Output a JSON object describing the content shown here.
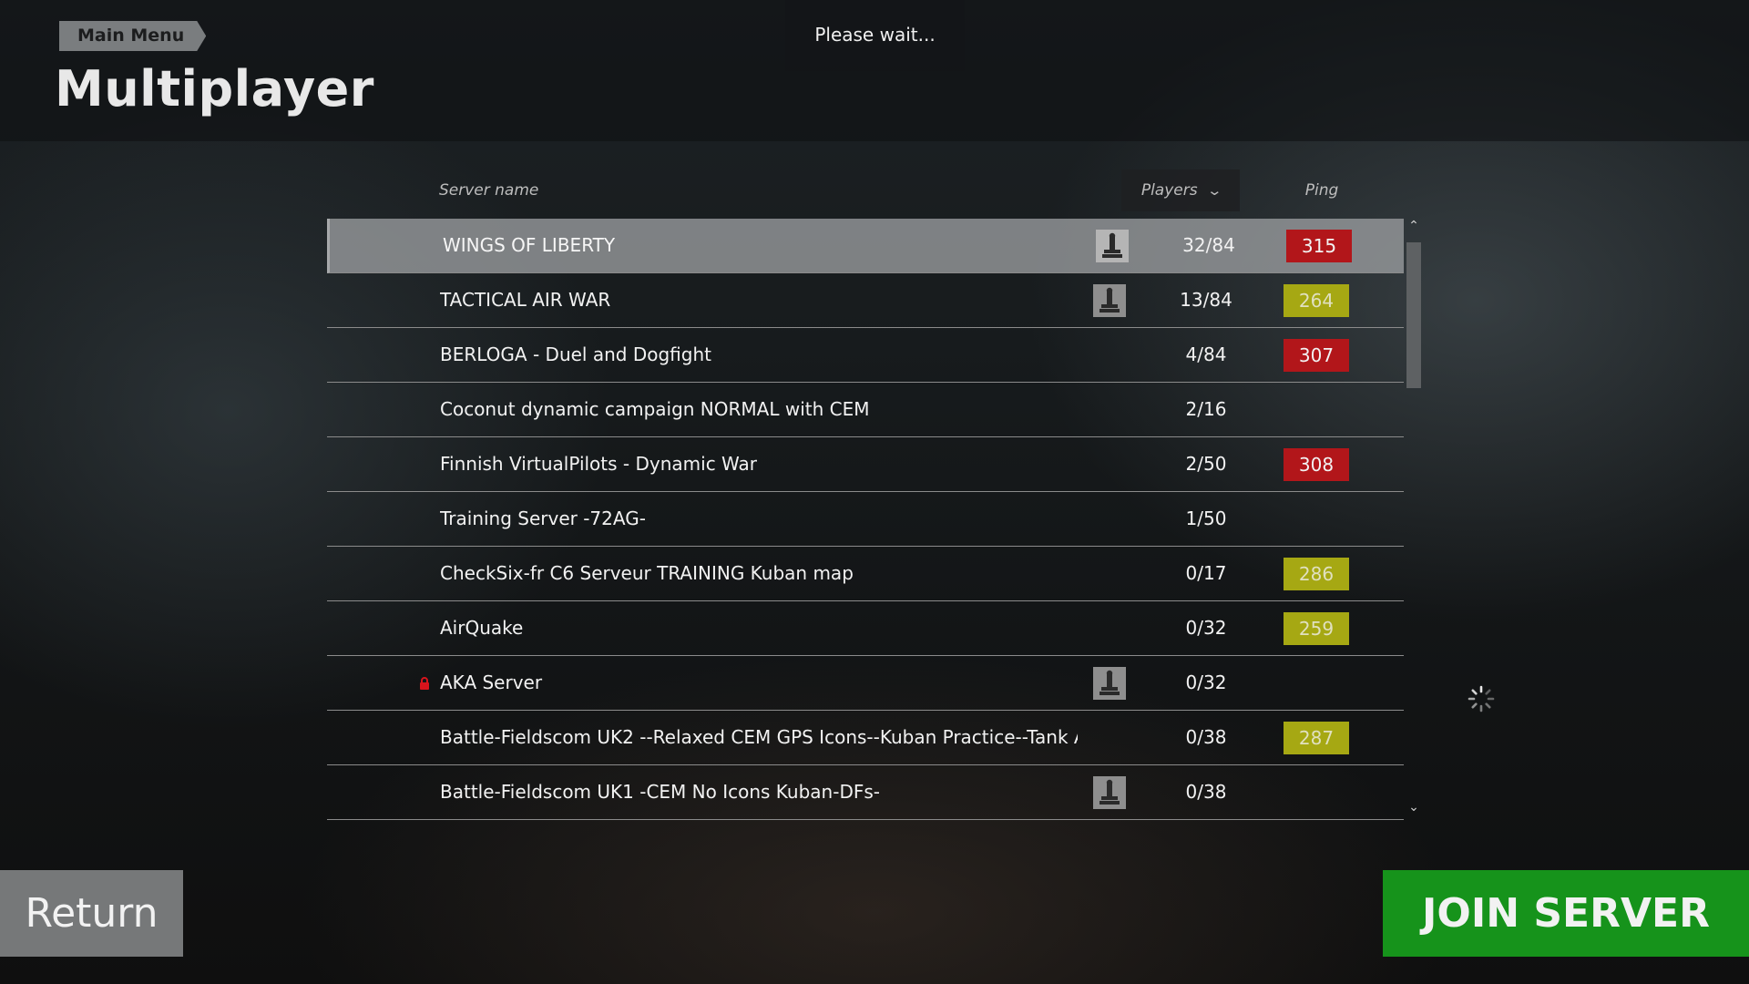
{
  "header": {
    "breadcrumb": "Main Menu",
    "title": "Multiplayer",
    "wait_message": "Please wait..."
  },
  "table": {
    "columns": {
      "server": "Server name",
      "players": "Players",
      "ping": "Ping"
    },
    "rows": [
      {
        "name": "WINGS OF LIBERTY",
        "players": "32/84",
        "ping": "315",
        "ping_level": "red",
        "mod_icon": true,
        "locked": false,
        "selected": true
      },
      {
        "name": "TACTICAL AIR WAR",
        "players": "13/84",
        "ping": "264",
        "ping_level": "yellow",
        "mod_icon": true,
        "locked": false,
        "selected": false
      },
      {
        "name": "BERLOGA - Duel and Dogfight",
        "players": "4/84",
        "ping": "307",
        "ping_level": "red",
        "mod_icon": false,
        "locked": false,
        "selected": false
      },
      {
        "name": "Coconut dynamic campaign NORMAL with CEM",
        "players": "2/16",
        "ping": "",
        "ping_level": "",
        "mod_icon": false,
        "locked": false,
        "selected": false
      },
      {
        "name": "Finnish VirtualPilots - Dynamic War",
        "players": "2/50",
        "ping": "308",
        "ping_level": "red",
        "mod_icon": false,
        "locked": false,
        "selected": false
      },
      {
        "name": "Training Server -72AG-",
        "players": "1/50",
        "ping": "",
        "ping_level": "",
        "mod_icon": false,
        "locked": false,
        "selected": false
      },
      {
        "name": "CheckSix-fr C6 Serveur TRAINING Kuban map",
        "players": "0/17",
        "ping": "286",
        "ping_level": "yellow",
        "mod_icon": false,
        "locked": false,
        "selected": false
      },
      {
        "name": "AirQuake",
        "players": "0/32",
        "ping": "259",
        "ping_level": "yellow",
        "mod_icon": false,
        "locked": false,
        "selected": false
      },
      {
        "name": "AKA Server",
        "players": "0/32",
        "ping": "",
        "ping_level": "",
        "mod_icon": true,
        "locked": true,
        "selected": false
      },
      {
        "name": "Battle-Fieldscom  UK2 --Relaxed CEM GPS Icons--Kuban Practice--Tank A",
        "players": "0/38",
        "ping": "287",
        "ping_level": "yellow",
        "mod_icon": false,
        "locked": false,
        "selected": false
      },
      {
        "name": "Battle-Fieldscom UK1 -CEM No Icons Kuban-DFs-",
        "players": "0/38",
        "ping": "",
        "ping_level": "",
        "mod_icon": true,
        "locked": false,
        "selected": false
      }
    ]
  },
  "footer": {
    "return_label": "Return",
    "join_label": "JOIN SERVER"
  },
  "colors": {
    "ping_red": "#b2161a",
    "ping_yellow": "#a6a813",
    "join_green": "#16931b",
    "return_gray": "#767879"
  },
  "icons": {
    "sort": "chevron-down-icon",
    "mod": "joystick-icon",
    "lock": "lock-icon",
    "loading": "loading-spinner-icon",
    "scroll_up": "chevron-up-icon",
    "scroll_down": "chevron-down-icon"
  }
}
